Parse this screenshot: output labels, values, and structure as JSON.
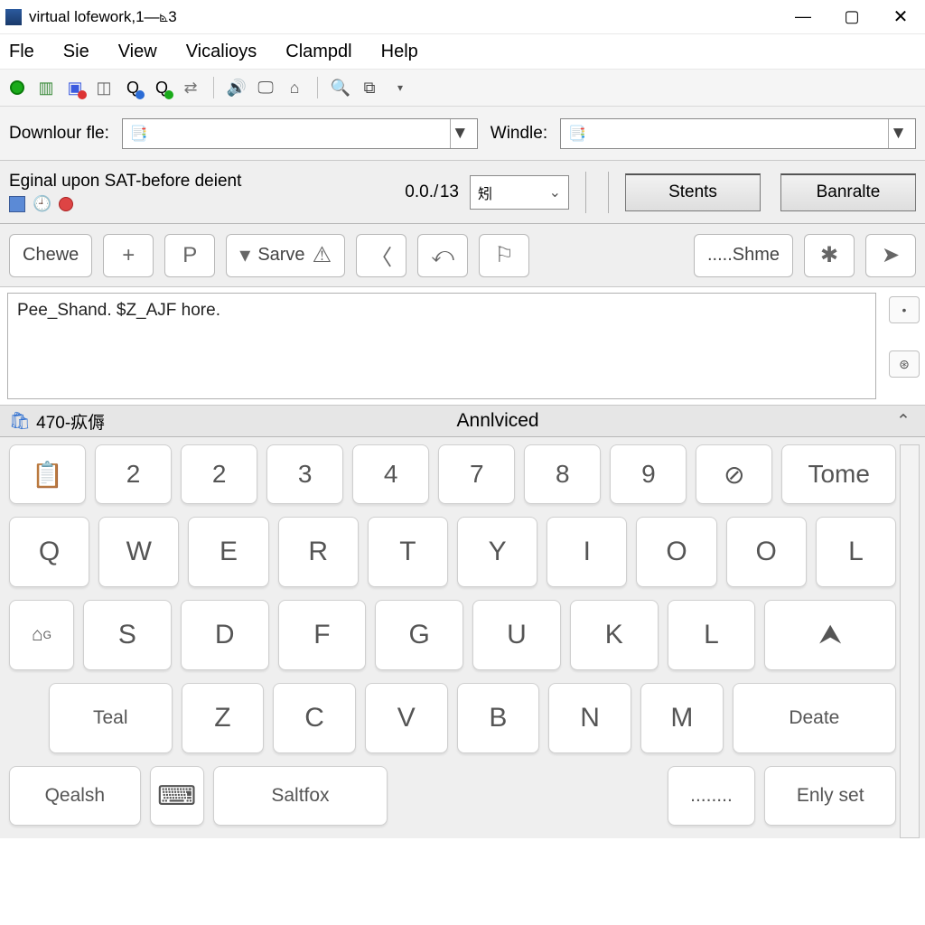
{
  "window": {
    "title": "virtual lofework,1—⦝3"
  },
  "menu": {
    "file": "Fle",
    "sie": "Sie",
    "view": "View",
    "vical": "Vicalioys",
    "clampdl": "Clampdl",
    "help": "Help"
  },
  "selectors": {
    "download_label": "Downlour fle:",
    "download_value": "",
    "download_icon": "📑",
    "windle_label": "Windle:",
    "windle_value": "",
    "windle_icon": "📑"
  },
  "params": {
    "status_line": "Eginal upon SAT-before deient",
    "value": "0.0./ 13",
    "unit_value": "矧",
    "stents_label": "Stents",
    "banralte_label": "Banralte"
  },
  "midbar": {
    "chew": "Chewe",
    "plus": "+",
    "p": "P",
    "save": "Sarve",
    "shme": ".....Shme"
  },
  "editor": {
    "content": "Pee_Shand. $Z_AJF hore."
  },
  "kb_header": {
    "code": "470-疭傉",
    "title": "Annlviced"
  },
  "keyboard": {
    "row0": [
      "📋",
      "2",
      "2",
      "3",
      "4",
      "7",
      "8",
      "9",
      "⊘",
      "Tome"
    ],
    "row1": [
      "Q",
      "W",
      "E",
      "R",
      "T",
      "Y",
      "I",
      "O",
      "O",
      "L"
    ],
    "row2_lead": "G",
    "row2": [
      "S",
      "D",
      "F",
      "G",
      "U",
      "K",
      "L"
    ],
    "row2_tail": "⮝",
    "row3_lead": "Teal",
    "row3": [
      "Z",
      "C",
      "V",
      "B",
      "N",
      "M"
    ],
    "row3_tail": "Deate",
    "row4": {
      "qealsh": "Qealsh",
      "salt": "Saltfox",
      "dots": "........",
      "enly": "Enly set"
    }
  }
}
